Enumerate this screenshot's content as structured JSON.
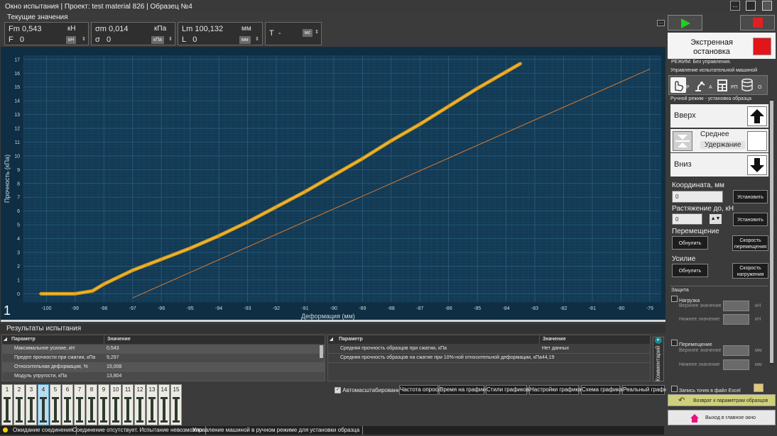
{
  "window": {
    "title": "Окно испытания | Проект: test material 826 | Образец №4",
    "menu_label": "..."
  },
  "current_values": {
    "title": "Текущие значения",
    "fm": {
      "label": "Fm",
      "value": "0,543",
      "unit": "кН"
    },
    "f": {
      "label": "F",
      "value": "0",
      "unit": "кН"
    },
    "sigma_m": {
      "label": "σm",
      "value": "0,014",
      "unit": "кПа"
    },
    "sigma": {
      "label": "σ",
      "value": "0",
      "unit": "кПа"
    },
    "lm": {
      "label": "Lm",
      "value": "100,132",
      "unit": "мм"
    },
    "l": {
      "label": "L",
      "value": "0",
      "unit": "мм"
    },
    "t": {
      "label": "T",
      "value": "-",
      "unit": "мс"
    },
    "more": "..."
  },
  "chart_data": {
    "type": "line",
    "xlabel": "Деформация (мм)",
    "ylabel": "Прочность (кПа)",
    "xlim": [
      -100.8,
      -78.6
    ],
    "ylim": [
      -0.6,
      17.3
    ],
    "x_ticks": [
      -100,
      -99,
      -98,
      -97,
      -96,
      -95,
      -94,
      -93,
      -92,
      -91,
      -90,
      -89,
      -88,
      -87,
      -86,
      -85,
      -84,
      -83,
      -82,
      -81,
      -80,
      -79
    ],
    "y_ticks": [
      0,
      1,
      2,
      3,
      4,
      5,
      6,
      7,
      8,
      9,
      10,
      11,
      12,
      13,
      14,
      15,
      16,
      17
    ],
    "grid": true,
    "series": [
      {
        "color": "#e8a317",
        "x": [
          -100.2,
          -99.0,
          -98.4,
          -98.0,
          -97.5,
          -97.0,
          -96.5,
          -96.0,
          -95.0,
          -94.0,
          -93.0,
          -92.0,
          -91.0,
          -90.0,
          -89.0,
          -88.0,
          -87.0,
          -86.0,
          -85.0,
          -84.5,
          -84.0,
          -83.5
        ],
        "y": [
          0.0,
          0.0,
          0.2,
          0.7,
          1.2,
          1.7,
          2.1,
          2.5,
          3.3,
          4.2,
          5.2,
          6.3,
          7.4,
          8.6,
          9.8,
          11.1,
          12.3,
          13.6,
          14.9,
          15.5,
          16.1,
          16.7
        ]
      },
      {
        "color": "#d9792b",
        "x": [
          -97.0,
          -79.0
        ],
        "y": [
          -0.3,
          16.3
        ]
      }
    ],
    "panel_label": "1"
  },
  "results": {
    "title": "Результаты испытания",
    "left_table": {
      "headers": [
        "Параметр",
        "Значение"
      ],
      "rows": [
        [
          "Максимальное усилие, кН",
          "0,543"
        ],
        [
          "Предел прочности при сжатии, кПа",
          "9,297"
        ],
        [
          "Относительная деформация, %",
          "15,008"
        ],
        [
          "Модуль упругости, кПа",
          "13,804"
        ]
      ]
    },
    "right_table": {
      "headers": [
        "Параметр",
        "Значение"
      ],
      "rows": [
        [
          "Средняя прочность образцов при сжатии, кПа",
          "Нет данных"
        ],
        [
          "Средняя прочность образцов на сжатие при 10%-ной относительной деформации, кПа",
          "44,19"
        ]
      ]
    },
    "comment_label": "Комментарий"
  },
  "samples": {
    "numbers": [
      "1",
      "2",
      "3",
      "4",
      "5",
      "6",
      "7",
      "8",
      "9",
      "10",
      "11",
      "12",
      "13",
      "14",
      "15"
    ],
    "active": "4"
  },
  "toolbar": {
    "autoscale_label": "Автомасштабирование",
    "buttons": [
      "Частота опроса",
      "Время на графике",
      "Стили графиков",
      "Настройки графика",
      "Схема графика",
      "Реальный график"
    ]
  },
  "status": {
    "segments": [
      "Ожидание соединения",
      "Соединение отсутствует. Испытание невозможно",
      "Управление машиной в ручном режиме для установки образца"
    ]
  },
  "control": {
    "emergency_stop": "Экстренная остановка",
    "mode_text": "РЕЖИМ: Без управления.",
    "machine_control": "Управление испытательной машиной",
    "mode_letters": [
      "Р",
      "А",
      "РП",
      "О"
    ],
    "mode_icons": [
      "hand-icon",
      "robot-arm-icon",
      "calculator-icon",
      "database-icon"
    ],
    "manual_mode": "Ручной режим - установка образца",
    "up": "Вверх",
    "middle_hold_1": "Среднее",
    "middle_hold_2": "Удержание",
    "down": "Вниз",
    "coordinate_label": "Координата, мм",
    "coordinate_value": "0",
    "set_label": "Установить",
    "stretch_label": "Растяжение до, кН",
    "stretch_value": "0",
    "movement_label": "Перемещение",
    "reset_label": "Обнулить",
    "move_speed_label": "Скорость перемещения",
    "force_label": "Усилие",
    "load_speed_label": "Скорость нагружения",
    "protection_label": "Защита",
    "load_label": "Нагрузка",
    "upper_value": "Верхнее значение",
    "lower_value": "Нижнее значение",
    "unit_kn": "кН",
    "move_label": "Перемещение",
    "unit_mm": "мм",
    "excel_label": "Запись точек в файл Excel",
    "back_label": "Возврат к параметрам образцов",
    "exit_label": "Выход в главное окно"
  }
}
